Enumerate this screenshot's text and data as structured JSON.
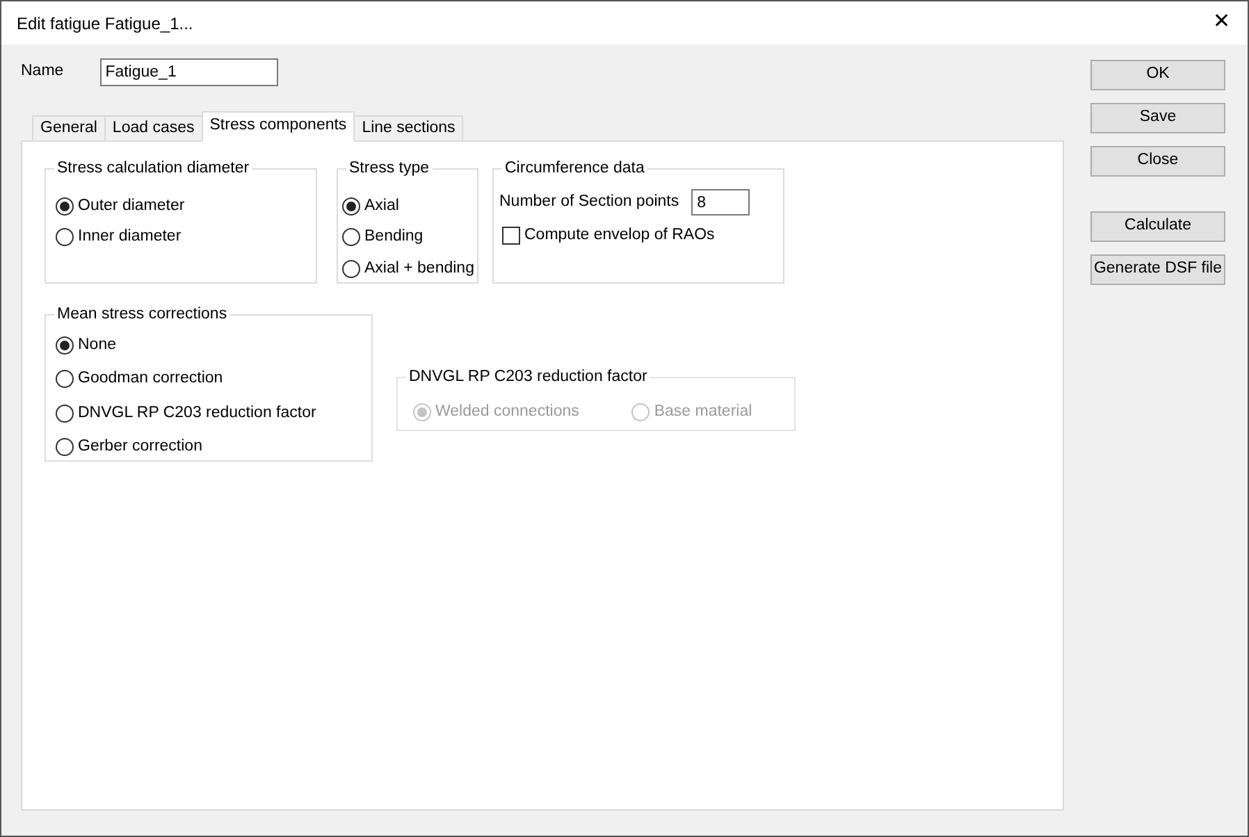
{
  "window": {
    "title": "Edit fatigue Fatigue_1...",
    "close": "✕"
  },
  "name_field": {
    "label": "Name",
    "value": "Fatigue_1"
  },
  "tabs": [
    {
      "label": "General",
      "selected": false
    },
    {
      "label": "Load cases",
      "selected": false
    },
    {
      "label": "Stress components",
      "selected": true
    },
    {
      "label": "Line sections",
      "selected": false
    }
  ],
  "stress_calculation_diameter": {
    "title": "Stress calculation diameter",
    "options": [
      {
        "label": "Outer diameter",
        "selected": true
      },
      {
        "label": "Inner diameter",
        "selected": false
      }
    ]
  },
  "stress_type": {
    "title": "Stress type",
    "options": [
      {
        "label": "Axial",
        "selected": true
      },
      {
        "label": "Bending",
        "selected": false
      },
      {
        "label": "Axial + bending",
        "selected": false
      }
    ]
  },
  "circumference_data": {
    "title": "Circumference data",
    "section_points_label": "Number of Section points",
    "section_points_value": "8",
    "envelope": {
      "label": "Compute envelop of RAOs",
      "checked": false
    }
  },
  "mean_stress_corrections": {
    "title": "Mean stress corrections",
    "options": [
      {
        "label": "None",
        "selected": true
      },
      {
        "label": "Goodman correction",
        "selected": false
      },
      {
        "label": "DNVGL RP C203 reduction factor",
        "selected": false
      },
      {
        "label": "Gerber correction",
        "selected": false
      }
    ]
  },
  "reduction_factor": {
    "title": "DNVGL RP C203 reduction factor",
    "disabled": true,
    "options": [
      {
        "label": "Welded connections",
        "selected": true
      },
      {
        "label": "Base material",
        "selected": false
      }
    ]
  },
  "buttons": [
    "OK",
    "Save",
    "Close"
  ],
  "action_buttons": [
    "Calculate",
    "Generate DSF file"
  ]
}
